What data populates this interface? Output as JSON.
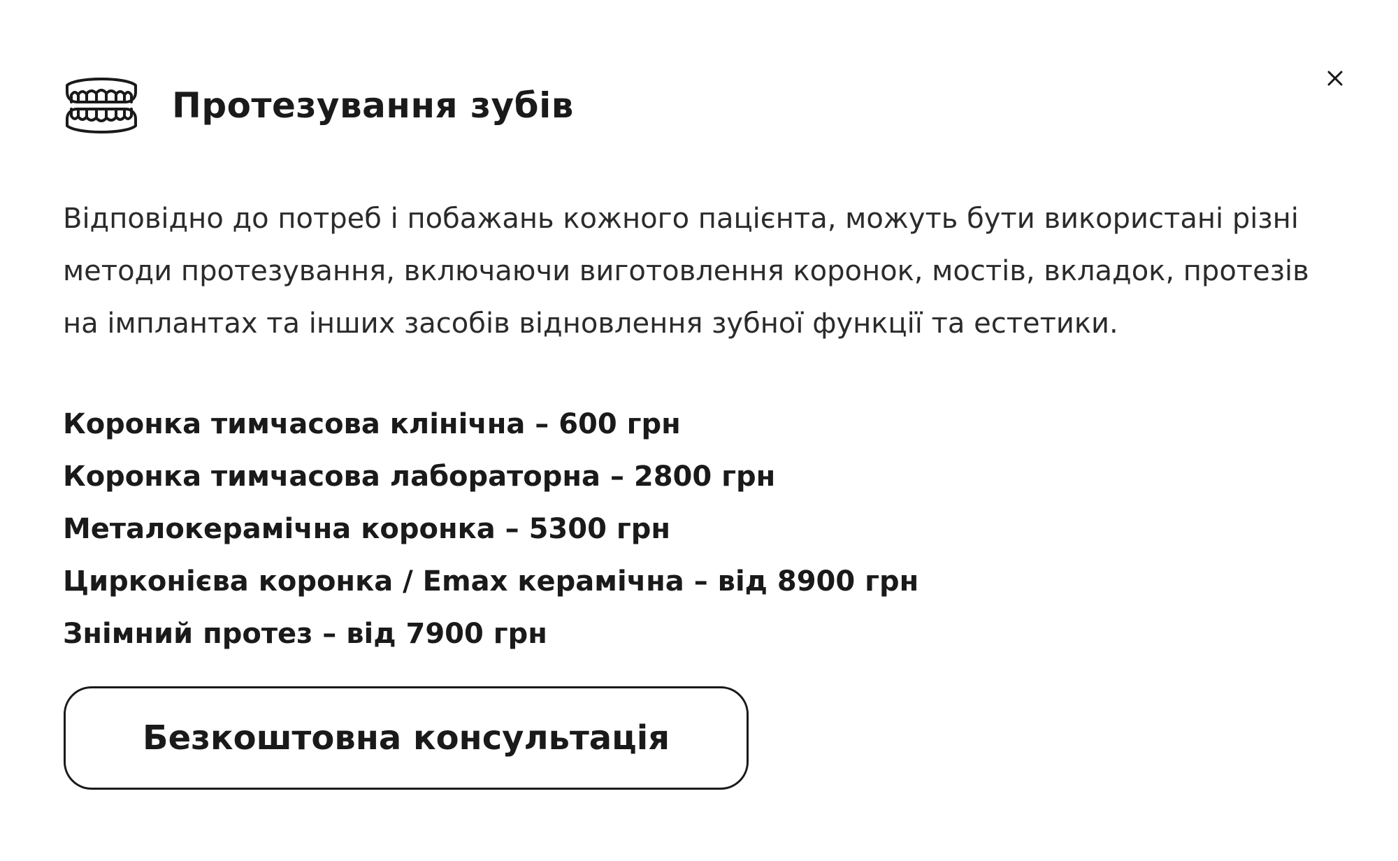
{
  "modal": {
    "title": "Протезування зубів",
    "icon": "dentures-icon",
    "close_icon": "close-icon",
    "description": "Відповідно до потреб і побажань кожного пацієнта, можуть бути використані різні методи протезування, включаючи виготовлення коронок, мостів, вкладок, протезів на імплантах та інших засобів відновлення зубної функції та естетики.",
    "prices": [
      "Коронка тимчасова клінічна – 600 грн",
      "Коронка тимчасова лабораторна – 2800 грн",
      "Металокерамічна коронка – 5300 грн",
      "Цирконієва коронка / Emax керамічна – від 8900 грн",
      "Знімний протез – від 7900 грн"
    ],
    "cta_label": "Безкоштовна консультація"
  },
  "colors": {
    "text": "#1a1a1a",
    "body_text": "#2b2b2b",
    "background": "#ffffff",
    "border": "#1a1a1a"
  }
}
